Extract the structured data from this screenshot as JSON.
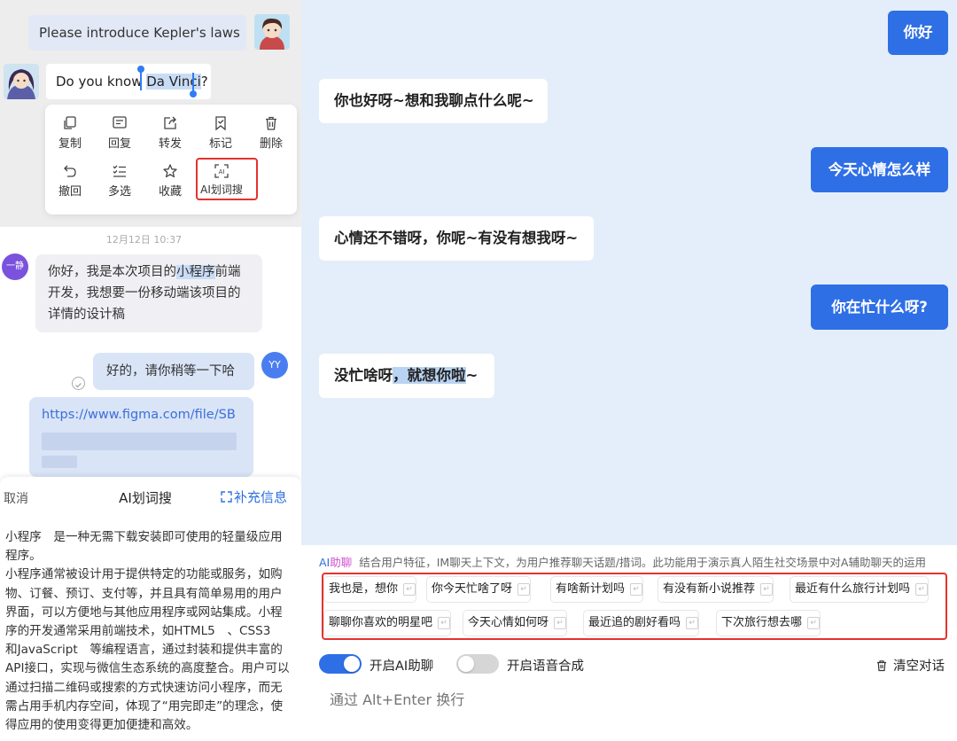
{
  "left": {
    "question_text": "Please introduce Kepler's laws",
    "davinci_prefix": "Do you know ",
    "davinci_selected": "Da Vinci",
    "davinci_suffix": "?",
    "context_menu": {
      "copy": "复制",
      "reply": "回复",
      "forward": "转发",
      "mark": "标记",
      "delete": "删除",
      "recall": "撤回",
      "multi_select": "多选",
      "favorite": "收藏",
      "ai_search": "AI划词搜"
    },
    "timestamp": "12月12日 10:37",
    "sender_avatar": "一静",
    "msg1_prefix": "你好，我是本次项目的",
    "msg1_highlight": "小程序",
    "msg1_suffix": "前端开发，我想要一份移动端该项目的详情的设计稿",
    "msg2": "好的，请你稍等一下哈",
    "me_avatar": "YY",
    "link_text": "https://www.figma.com/file/SB",
    "sheet": {
      "cancel": "取消",
      "title": "AI划词搜",
      "more": "补充信息",
      "para1": "小程序　是一种无需下载安装即可使用的轻量级应用程序。",
      "para2": "小程序通常被设计用于提供特定的功能或服务，如购物、订餐、预订、支付等，并且具有简单易用的用户界面，可以方便地与其他应用程序或网站集成。小程序的开发通常采用前端技术，如HTML5　、CSS3　和JavaScript　等编程语言，通过封装和提供丰富的API接口，实现与微信生态系统的高度整合。用户可以通过扫描二维码或搜索的方式快速访问小程序，而无需占用手机内存空间，体现了“用完即走”的理念，使得应用的使用变得更加便捷和高效。"
    }
  },
  "right": {
    "messages": [
      {
        "role": "user",
        "text": "你好"
      },
      {
        "role": "bot",
        "text": "你也好呀~想和我聊点什么呢~"
      },
      {
        "role": "user",
        "text": "今天心情怎么样"
      },
      {
        "role": "bot",
        "text": "心情还不错呀，你呢~有没有想我呀~"
      },
      {
        "role": "user",
        "text": "你在忙什么呀?"
      },
      {
        "role": "bot",
        "text_prefix": "没忙啥呀",
        "text_highlight": "，就想你啦",
        "text_suffix": "~"
      }
    ],
    "ai_bar": {
      "tag_a": "AI",
      "tag_b": "助聊",
      "description": "结合用户特征，IM聊天上下文，为用户推荐聊天话题/措词。此功能用于演示真人陌生社交场景中对A辅助聊天的运用",
      "suggestions_row1": [
        "我也是，想你",
        "你今天忙啥了呀",
        "有啥新计划吗",
        "有没有新小说推荐",
        "最近有什么旅行计划吗"
      ],
      "suggestions_row2": [
        "聊聊你喜欢的明星吧",
        "今天心情如何呀",
        "最近追的剧好看吗",
        "下次旅行想去哪"
      ]
    },
    "controls": {
      "ai_toggle_label": "开启AI助聊",
      "ai_toggle_on": true,
      "voice_toggle_label": "开启语音合成",
      "voice_toggle_on": false,
      "clear_label": "清空对话"
    },
    "input_placeholder": "通过 Alt+Enter 换行"
  },
  "colors": {
    "accent_blue": "#2f6fe6",
    "highlight_red": "#e5322d",
    "chat_bg": "#e4eefa"
  }
}
